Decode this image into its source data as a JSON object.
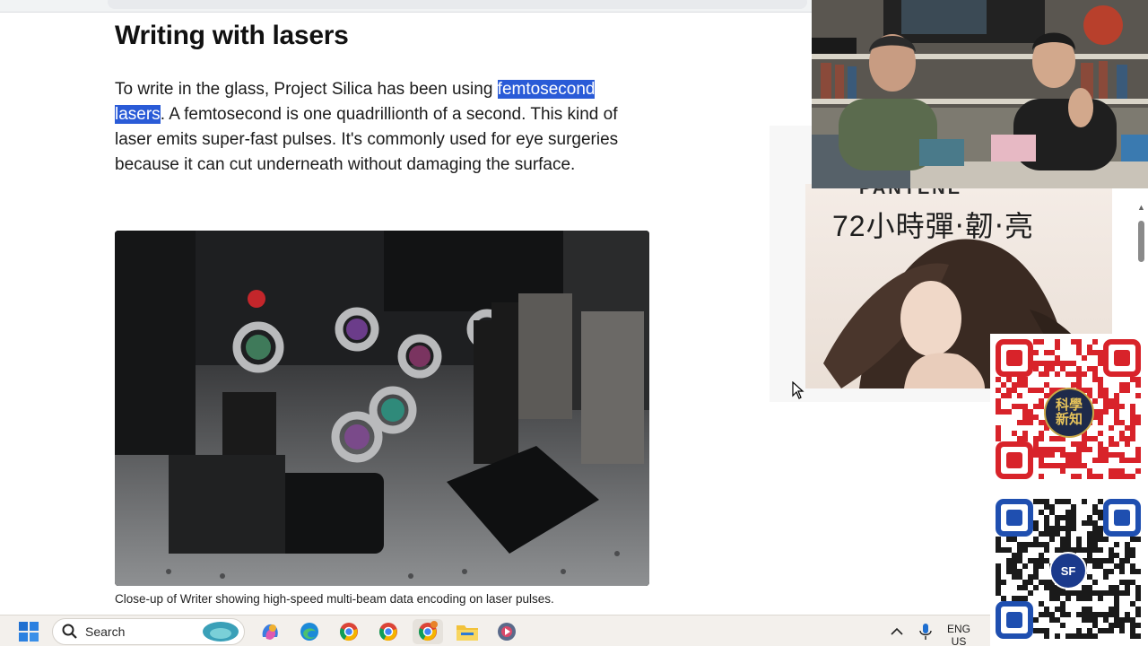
{
  "article": {
    "heading": "Writing with lasers",
    "paragraph": {
      "before": "To write in the glass, Project Silica has been using ",
      "highlight": "femtosecond lasers",
      "after": ". A femtosecond is one quadrillionth of a second. This kind of laser emits super-fast pulses. It's commonly used for eye surgeries because it can cut underneath without damaging the surface."
    },
    "caption": "Close-up of Writer showing high-speed multi-beam data encoding on laser pulses."
  },
  "ad": {
    "brand": "PANTENE",
    "slogan": "72小時彈‧韌‧亮",
    "colors": {
      "accent": "#2a2a2a"
    }
  },
  "qr": {
    "badge1": "科學新知",
    "badge2": "SF"
  },
  "taskbar": {
    "search_label": "Search",
    "language_line1": "ENG",
    "language_line2": "US",
    "icons": [
      "windows-start-icon",
      "search-icon",
      "widget-icon",
      "copilot-icon",
      "edge-icon",
      "chrome-icon",
      "chrome-icon",
      "chrome-icon",
      "file-explorer-icon",
      "media-player-icon",
      "chevron-up-icon",
      "microphone-icon"
    ]
  },
  "colors": {
    "highlight": "#2a5bd7",
    "taskbar": "#f3f0ec"
  }
}
